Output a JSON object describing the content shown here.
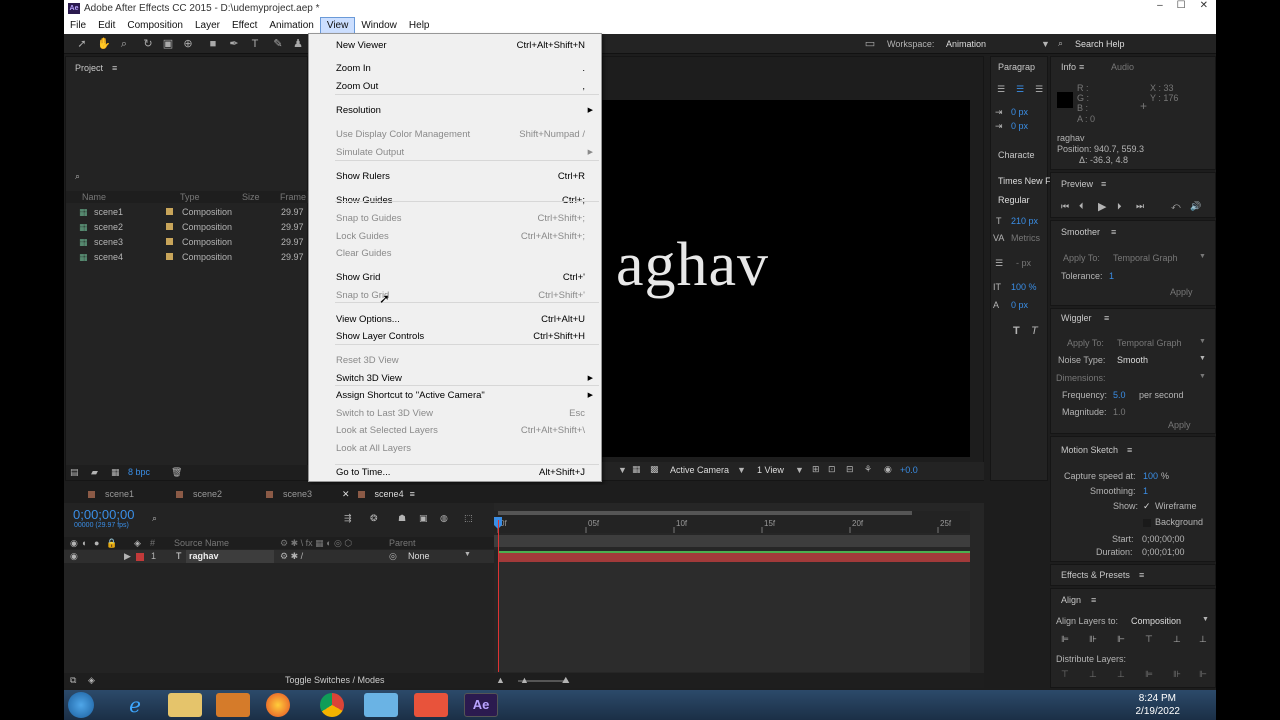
{
  "window": {
    "title": "Adobe After Effects CC 2015 - D:\\udemyproject.aep *",
    "min": "–",
    "max": "☐",
    "close": "✕"
  },
  "menubar": [
    "File",
    "Edit",
    "Composition",
    "Layer",
    "Effect",
    "Animation",
    "View",
    "Window",
    "Help"
  ],
  "toolbar": {
    "workspace_label": "Workspace:",
    "workspace_value": "Animation",
    "search_placeholder": "Search Help"
  },
  "project": {
    "title": "Project",
    "columns": {
      "name": "Name",
      "type": "Type",
      "size": "Size",
      "frame": "Frame ..."
    },
    "items": [
      {
        "name": "scene1",
        "type": "Composition",
        "frame": "29.97"
      },
      {
        "name": "scene2",
        "type": "Composition",
        "frame": "29.97"
      },
      {
        "name": "scene3",
        "type": "Composition",
        "frame": "29.97"
      },
      {
        "name": "scene4",
        "type": "Composition",
        "frame": "29.97"
      }
    ],
    "bpc": "8 bpc"
  },
  "view_menu": [
    {
      "label": "New Viewer",
      "shortcut": "Ctrl+Alt+Shift+N",
      "enabled": true
    },
    {
      "label": "Zoom In",
      "shortcut": ".",
      "enabled": true
    },
    {
      "label": "Zoom Out",
      "shortcut": ",",
      "enabled": true
    },
    {
      "label": "Resolution",
      "shortcut": "",
      "enabled": true,
      "submenu": true
    },
    {
      "label": "Use Display Color Management",
      "shortcut": "Shift+Numpad /",
      "enabled": false
    },
    {
      "label": "Simulate Output",
      "shortcut": "",
      "enabled": false,
      "submenu": true
    },
    {
      "label": "Show Rulers",
      "shortcut": "Ctrl+R",
      "enabled": true
    },
    {
      "label": "Show Guides",
      "shortcut": "Ctrl+;",
      "enabled": true
    },
    {
      "label": "Snap to Guides",
      "shortcut": "Ctrl+Shift+;",
      "enabled": false
    },
    {
      "label": "Lock Guides",
      "shortcut": "Ctrl+Alt+Shift+;",
      "enabled": false
    },
    {
      "label": "Clear Guides",
      "shortcut": "",
      "enabled": false
    },
    {
      "label": "Show Grid",
      "shortcut": "Ctrl+'",
      "enabled": true
    },
    {
      "label": "Snap to Grid",
      "shortcut": "Ctrl+Shift+'",
      "enabled": false
    },
    {
      "label": "View Options...",
      "shortcut": "Ctrl+Alt+U",
      "enabled": true
    },
    {
      "label": "Show Layer Controls",
      "shortcut": "Ctrl+Shift+H",
      "enabled": true
    },
    {
      "label": "Reset 3D View",
      "shortcut": "",
      "enabled": false
    },
    {
      "label": "Switch 3D View",
      "shortcut": "",
      "enabled": true,
      "submenu": true
    },
    {
      "label": "Assign Shortcut to \"Active Camera\"",
      "shortcut": "",
      "enabled": true,
      "submenu": true
    },
    {
      "label": "Switch to Last 3D View",
      "shortcut": "Esc",
      "enabled": false
    },
    {
      "label": "Look at Selected Layers",
      "shortcut": "Ctrl+Alt+Shift+\\",
      "enabled": false
    },
    {
      "label": "Look at All Layers",
      "shortcut": "",
      "enabled": false
    },
    {
      "label": "Go to Time...",
      "shortcut": "Alt+Shift+J",
      "enabled": true
    }
  ],
  "comp": {
    "text": "aghav",
    "camera": "Active Camera",
    "views": "1 View",
    "offset": "+0.0"
  },
  "paragraph": {
    "title": "Paragrap",
    "indent1": "0 px",
    "indent2": "0 px"
  },
  "character": {
    "title": "Characte",
    "font": "Times New F",
    "style": "Regular",
    "size": "210 px",
    "tracking": "Metrics",
    "leading": "- px",
    "vscale": "100 %",
    "baseline": "0 px"
  },
  "info": {
    "tab1": "Info",
    "tab2": "Audio",
    "r": "R :",
    "g": "G :",
    "b": "B :",
    "a": "A : 0",
    "x": "X : 33",
    "y": "Y : 176",
    "layer": "raghav",
    "position": "Position: 940.7, 559.3",
    "delta": "Δ: -36.3, 4.8"
  },
  "preview": {
    "title": "Preview"
  },
  "smoother": {
    "title": "Smoother",
    "apply_label": "Apply To:",
    "apply_value": "Temporal Graph",
    "tolerance_label": "Tolerance:",
    "tolerance_value": "1",
    "apply_btn": "Apply"
  },
  "wiggler": {
    "title": "Wiggler",
    "apply_label": "Apply To:",
    "apply_value": "Temporal Graph",
    "noise_label": "Noise Type:",
    "noise_value": "Smooth",
    "dim_label": "Dimensions:",
    "freq_label": "Frequency:",
    "freq_value": "5.0",
    "freq_unit": "per second",
    "mag_label": "Magnitude:",
    "mag_value": "1.0",
    "apply_btn": "Apply"
  },
  "motion_sketch": {
    "title": "Motion Sketch",
    "capture_label": "Capture speed at:",
    "capture_value": "100",
    "capture_unit": "%",
    "smoothing_label": "Smoothing:",
    "smoothing_value": "1",
    "show_label": "Show:",
    "wireframe": "Wireframe",
    "background": "Background",
    "start_label": "Start:",
    "start_value": "0;00;00;00",
    "duration_label": "Duration:",
    "duration_value": "0;00;01;00"
  },
  "effects_presets": {
    "title": "Effects & Presets"
  },
  "align": {
    "title": "Align",
    "layers_to_label": "Align Layers to:",
    "layers_to_value": "Composition",
    "distribute_label": "Distribute Layers:"
  },
  "timeline": {
    "tabs": [
      "scene1",
      "scene2",
      "scene3",
      "scene4"
    ],
    "timecode": "0;00;00;00",
    "fps": "00000 (29.97 fps)",
    "col_source": "Source Name",
    "col_parent": "Parent",
    "layer": {
      "num": "1",
      "name": "raghav",
      "parent": "None"
    },
    "ruler": [
      "0f",
      "05f",
      "10f",
      "15f",
      "20f",
      "25f"
    ],
    "toggle": "Toggle Switches / Modes"
  },
  "taskbar": {
    "time": "8:24 PM",
    "date": "2/19/2022"
  }
}
